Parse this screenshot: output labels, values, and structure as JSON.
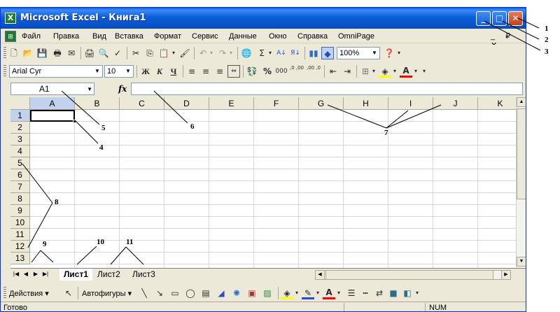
{
  "window": {
    "title": "Microsoft Excel - Книга1",
    "min_label": "_",
    "max_label": "□",
    "close_label": "✕"
  },
  "menu": {
    "items": [
      "Файл",
      "Правка",
      "Вид",
      "Вставка",
      "Формат",
      "Сервис",
      "Данные",
      "Окно",
      "Справка",
      "OmniPage"
    ],
    "doc_controls": "_ ₽ ✕"
  },
  "standard_toolbar": {
    "zoom": "100%"
  },
  "format_toolbar": {
    "font_name": "Arial Cyr",
    "font_size": "10",
    "bold": "Ж",
    "italic": "К",
    "underline": "Ч",
    "percent": "%",
    "thousands": "000",
    "inc_decimal": "‚0 ,00",
    "dec_decimal": ",00 ‚0"
  },
  "formula_bar": {
    "cell_ref": "A1",
    "fx": "fx",
    "value": ""
  },
  "grid": {
    "columns": [
      "A",
      "B",
      "C",
      "D",
      "E",
      "F",
      "G",
      "H",
      "I",
      "J",
      "K"
    ],
    "rows": [
      "1",
      "2",
      "3",
      "4",
      "5",
      "6",
      "7",
      "8",
      "9",
      "10",
      "11",
      "12",
      "13"
    ],
    "active_cell": "A1"
  },
  "sheets": {
    "tabs": [
      "Лист1",
      "Лист2",
      "Лист3"
    ],
    "active": "Лист1"
  },
  "draw_toolbar": {
    "actions": "Действия",
    "autoshapes": "Автофигуры"
  },
  "status": {
    "text": "Готово",
    "num": "NUM"
  },
  "callouts": [
    "1",
    "2",
    "3",
    "4",
    "5",
    "6",
    "7",
    "8",
    "9",
    "10",
    "11"
  ],
  "colors": {
    "titlebar": "#0b5ed7",
    "close": "#c3401e",
    "chrome": "#ece9d8",
    "selected_header": "#c1d2ee",
    "gridline": "#d0d7e5"
  }
}
